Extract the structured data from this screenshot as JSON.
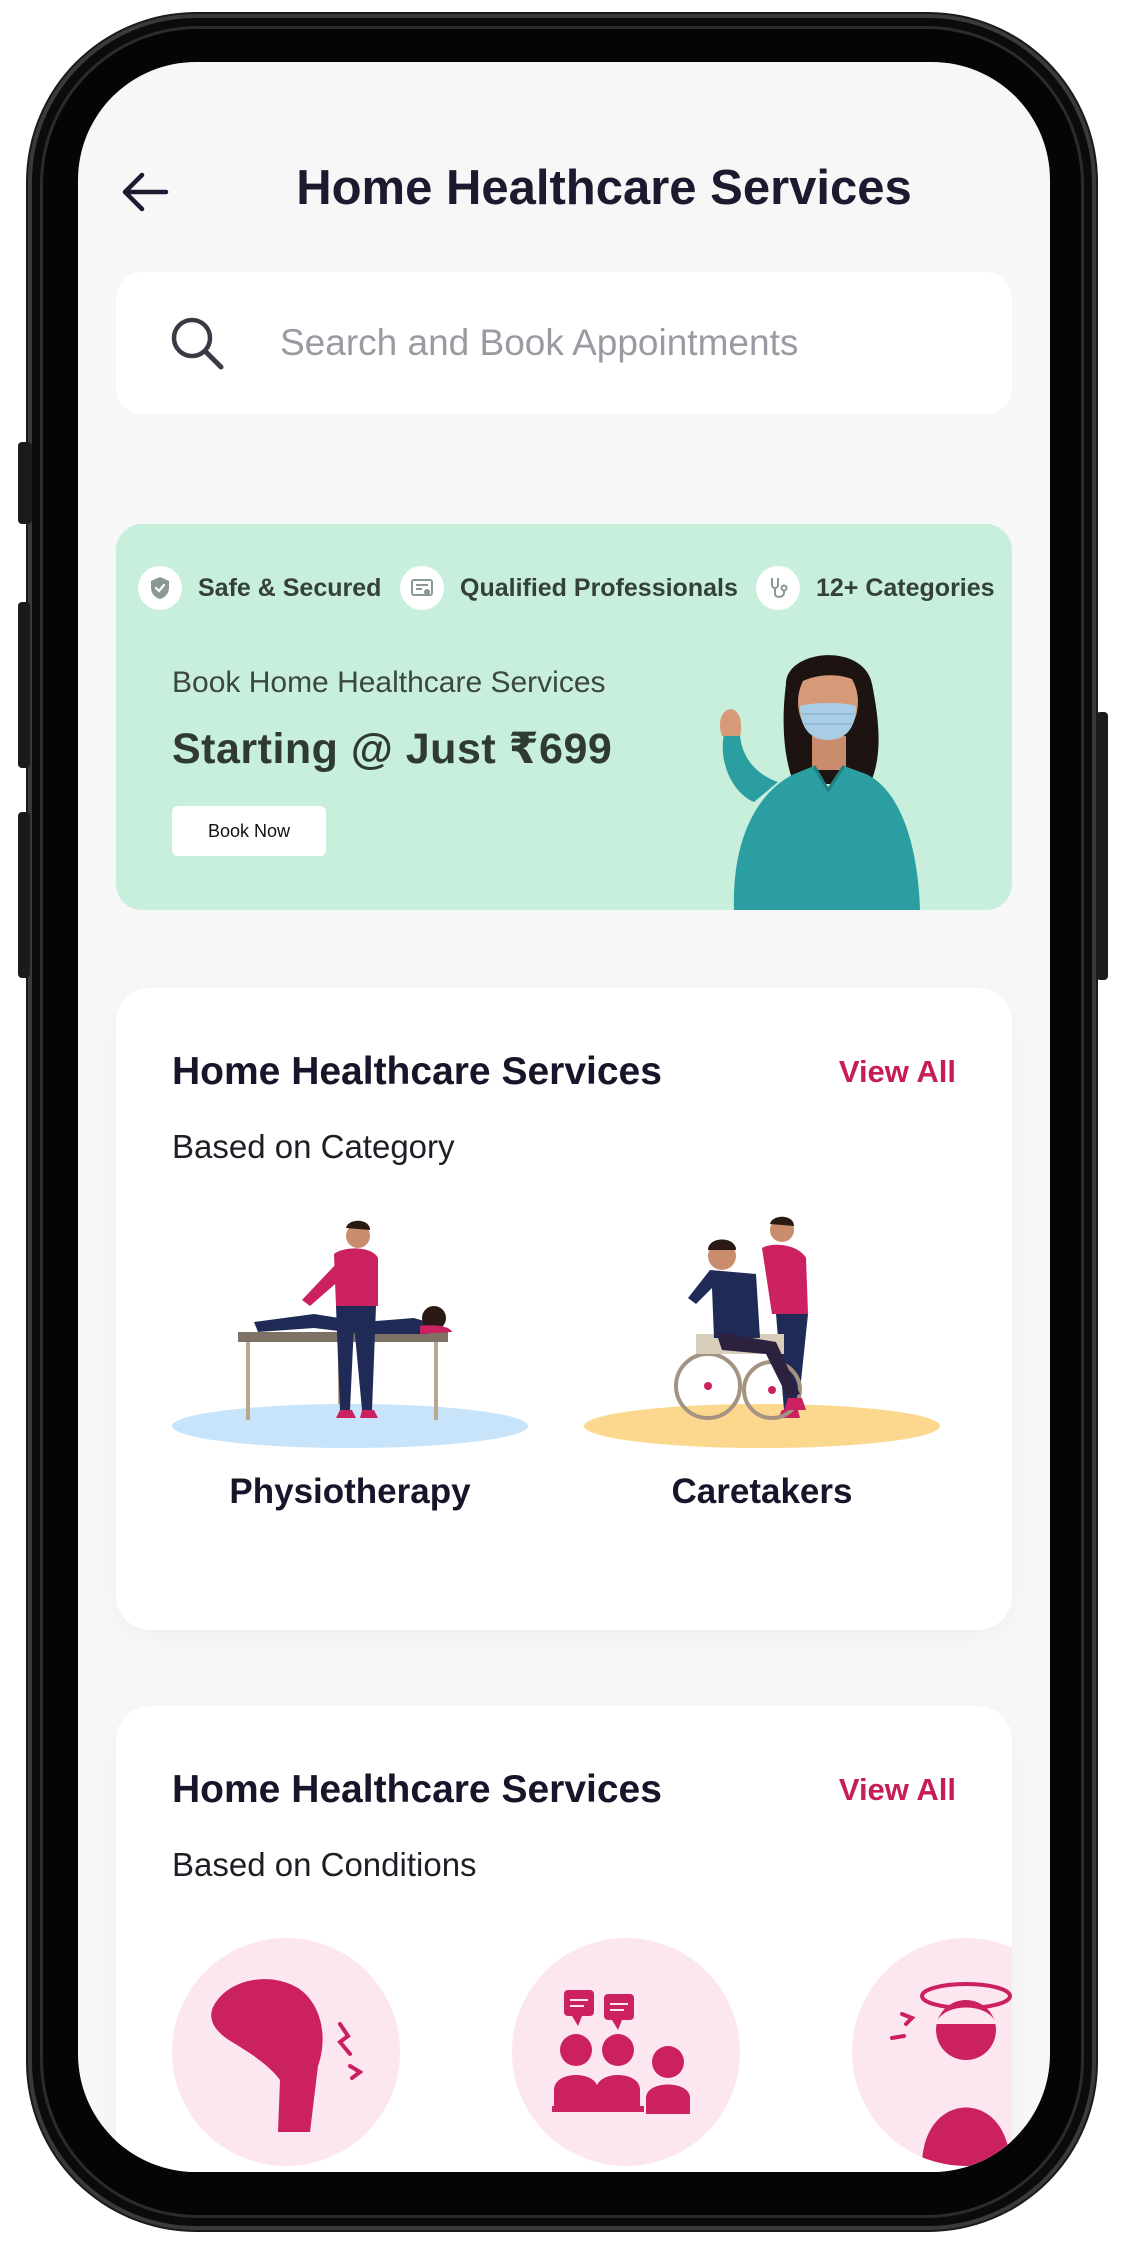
{
  "header": {
    "title": "Home Healthcare Services",
    "back_icon": "arrow-left-icon"
  },
  "search": {
    "placeholder": "Search and Book Appointments",
    "value": "",
    "icon": "search-icon"
  },
  "banner": {
    "features": [
      {
        "icon": "shield-check-icon",
        "label": "Safe & Secured"
      },
      {
        "icon": "certificate-icon",
        "label": "Qualified Professionals"
      },
      {
        "icon": "stethoscope-icon",
        "label": "12+ Categories"
      }
    ],
    "subtitle": "Book Home Healthcare Services",
    "price_text": "Starting @ Just ₹699",
    "button_label": "Book Now",
    "background_color": "#c8efdc"
  },
  "sections": [
    {
      "title": "Home Healthcare Services",
      "view_all": "View All",
      "subtitle": "Based on Category",
      "items": [
        {
          "label": "Physiotherapy",
          "illustration": "physiotherapy-illustration"
        },
        {
          "label": "Caretakers",
          "illustration": "caretaker-illustration"
        }
      ]
    },
    {
      "title": "Home Healthcare Services",
      "view_all": "View All",
      "subtitle": "Based on Conditions",
      "items": [
        {
          "icon": "knee-pain-icon"
        },
        {
          "icon": "group-discussion-icon"
        },
        {
          "icon": "headache-icon"
        }
      ]
    }
  ],
  "colors": {
    "accent": "#c61c57",
    "icon_pink": "#cc2160",
    "circle_bg": "#fce6f0",
    "screen_bg": "#f7f7f8"
  }
}
